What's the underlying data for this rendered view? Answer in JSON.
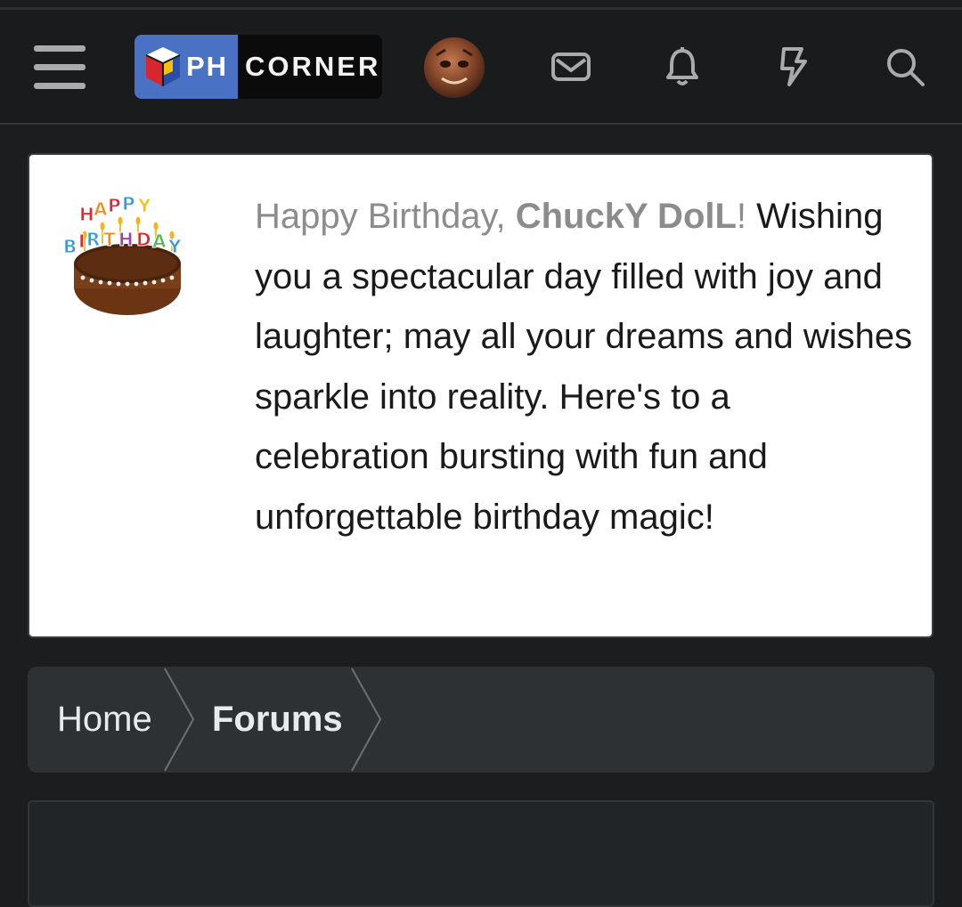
{
  "header": {
    "logo_ph": "PH",
    "logo_corner": "CORNER",
    "icons": [
      "menu-icon",
      "envelope-icon",
      "bell-icon",
      "lightning-icon",
      "search-icon"
    ]
  },
  "birthday": {
    "greeting_prefix": "Happy Birthday, ",
    "username": "ChuckY DolL",
    "greeting_suffix": "!",
    "message": "Wishing you a spectacular day filled with joy and laughter; may all your dreams and wishes sparkle into reality. Here's to a celebration bursting with fun and unforgettable birthday magic!",
    "cake_text": "HAPPY BIRTHDAY"
  },
  "breadcrumb": {
    "home": "Home",
    "forums": "Forums"
  },
  "colors": {
    "page_bg": "#1c1d1f",
    "header_bg": "#1a1b1d",
    "logo_blue": "#4a72c4",
    "card_bg": "#ffffff",
    "breadcrumb_bg": "#2e3134",
    "icon_gray": "#a9aaac"
  }
}
